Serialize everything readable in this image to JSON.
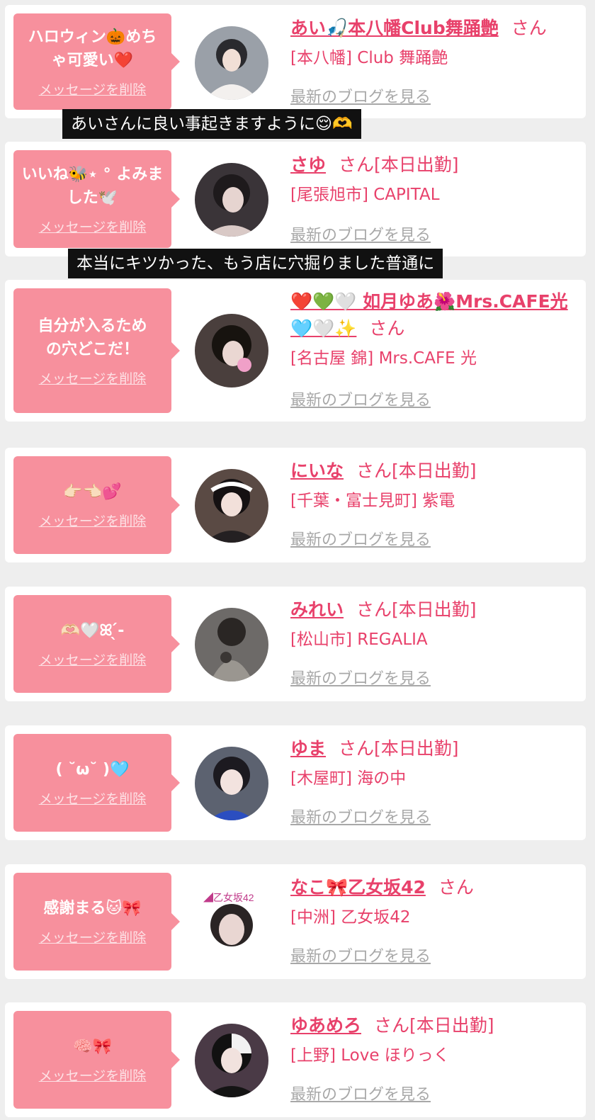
{
  "delete_label": "メッセージを削除",
  "blog_label": "最新のブログを見る",
  "san_label": "さん",
  "captions": [
    "あいさんに良い事起きますように😌🫶",
    "本当にキツかった、もう店に穴掘りました普通に"
  ],
  "colors": {
    "accent": "#e8416b",
    "bubble": "#f7909d",
    "background": "#eeeeee"
  },
  "cards": [
    {
      "message": "ハロウィン🎃めちゃ可愛い❤️",
      "name": "あい🎣本八幡Club舞踊艶",
      "status": "",
      "shop": "[本八幡] Club 舞踊艶"
    },
    {
      "message": "いいね🐝⋆ ° よみました🕊️",
      "name": "さゆ",
      "status": "[本日出勤]",
      "shop": "[尾張旭市] CAPITAL"
    },
    {
      "message": "自分が入るための穴どこだ！",
      "name": "❤️💚🤍 如月ゆあ🌺Mrs.CAFE光🩵🤍✨",
      "status": "",
      "shop": "[名古屋 錦] Mrs.CAFE 光"
    },
    {
      "message": "👉🏻👈🏻💕",
      "name": "にいな",
      "status": "[本日出勤]",
      "shop": "[千葉・富士見町] 紫電"
    },
    {
      "message": "🫶🏻🤍ꕤ ̖́-",
      "name": "みれい",
      "status": "[本日出勤]",
      "shop": "[松山市] REGALIA"
    },
    {
      "message": "( ˘ω˘ )🩵",
      "name": "ゆま",
      "status": "[本日出勤]",
      "shop": "[木屋町] 海の中"
    },
    {
      "message": "感謝まる🐱🎀",
      "name": "なこ🎀乙女坂42",
      "status": "",
      "shop": "[中洲] 乙女坂42"
    },
    {
      "message": "🧠🎀",
      "name": "ゆあめろ",
      "status": "[本日出勤]",
      "shop": "[上野] Love ほりっく"
    }
  ]
}
